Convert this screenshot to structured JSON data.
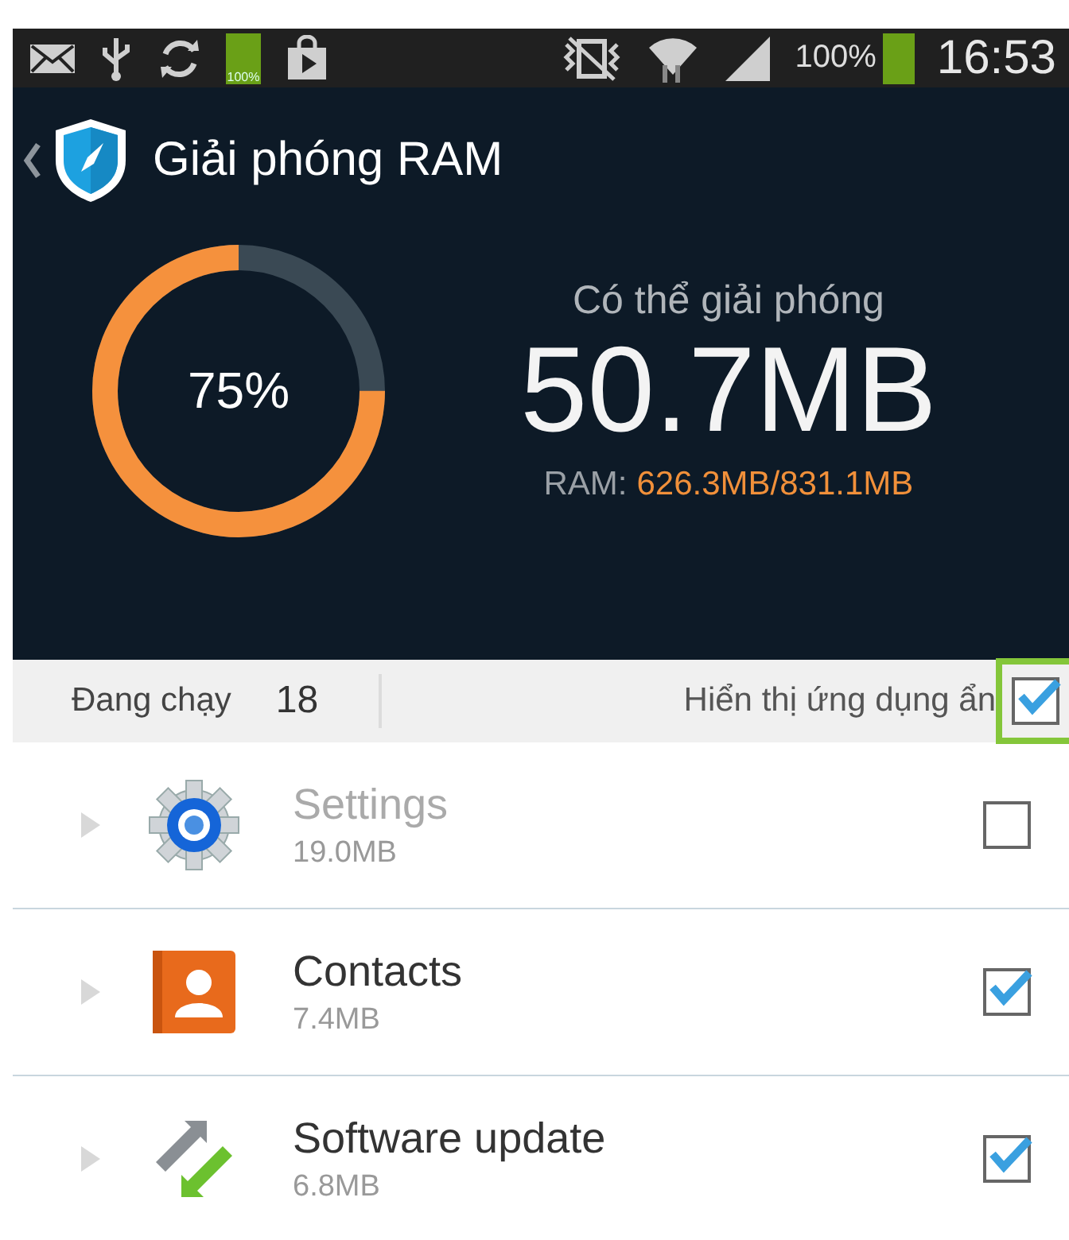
{
  "status_bar": {
    "battery_small_label": "100%",
    "battery_percent": "100%",
    "time": "16:53"
  },
  "header": {
    "title": "Giải phóng RAM"
  },
  "summary": {
    "gauge_label": "75%",
    "level": 0.75,
    "caption": "Có thể giải phóng",
    "amount": "50.7MB",
    "ram_label": "RAM:",
    "ram_value": "626.3MB/831.1MB"
  },
  "filter_bar": {
    "running_label": "Đang chạy",
    "running_count": "18",
    "hidden_apps_label": "Hiển thị ứng dụng ẩn",
    "hidden_apps_checked": true,
    "highlighted": true
  },
  "apps": [
    {
      "kind": "settings",
      "name": "Settings",
      "size": "19.0MB",
      "checked": false,
      "disabled": true
    },
    {
      "kind": "contacts",
      "name": "Contacts",
      "size": "7.4MB",
      "checked": true,
      "disabled": false
    },
    {
      "kind": "update",
      "name": "Software update",
      "size": "6.8MB",
      "checked": true,
      "disabled": false
    }
  ]
}
